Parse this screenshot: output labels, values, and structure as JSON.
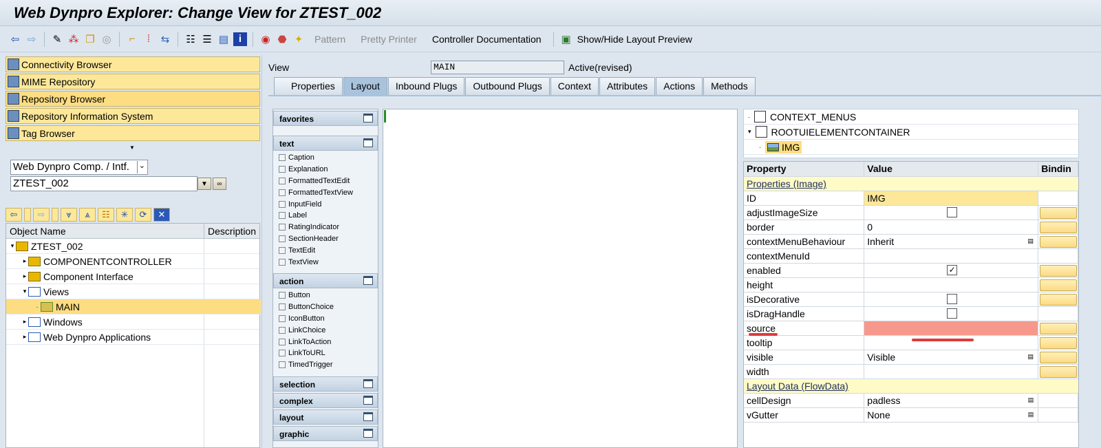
{
  "title": "Web Dynpro Explorer: Change View for ZTEST_002",
  "toolbar": {
    "icons": [
      "back-icon",
      "forward-icon",
      "edit-icon",
      "activate-icon",
      "copy-icon",
      "spiral-icon",
      "hierarchy-up-icon",
      "wand-icon",
      "navigate-icon",
      "tree-icon",
      "stack-icon",
      "layout-icon",
      "info-icon",
      "check-icon",
      "stop-user-icon",
      "magic-icon"
    ],
    "pattern": "Pattern",
    "pretty_printer": "Pretty Printer",
    "controller_doc": "Controller Documentation",
    "layout_preview": "Show/Hide Layout Preview"
  },
  "nav": [
    "Connectivity Browser",
    "MIME Repository",
    "Repository Browser",
    "Repository Information System",
    "Tag Browser"
  ],
  "object_type": "Web Dynpro Comp. / Intf.",
  "object_name": "ZTEST_002",
  "tree": {
    "col_name": "Object Name",
    "col_desc": "Description",
    "items": [
      {
        "label": "ZTEST_002",
        "level": 0
      },
      {
        "label": "COMPONENTCONTROLLER",
        "level": 1
      },
      {
        "label": "Component Interface",
        "level": 1
      },
      {
        "label": "Views",
        "level": 1
      },
      {
        "label": "MAIN",
        "level": 2
      },
      {
        "label": "Windows",
        "level": 1
      },
      {
        "label": "Web Dynpro Applications",
        "level": 1
      }
    ]
  },
  "view": {
    "label": "View",
    "name": "MAIN",
    "status": "Active(revised)"
  },
  "tabs": [
    "Properties",
    "Layout",
    "Inbound Plugs",
    "Outbound Plugs",
    "Context",
    "Attributes",
    "Actions",
    "Methods"
  ],
  "palette": {
    "favorites": "favorites",
    "text": "text",
    "text_items": [
      "Caption",
      "Explanation",
      "FormattedTextEdit",
      "FormattedTextView",
      "InputField",
      "Label",
      "RatingIndicator",
      "SectionHeader",
      "TextEdit",
      "TextView"
    ],
    "action": "action",
    "action_items": [
      "Button",
      "ButtonChoice",
      "IconButton",
      "LinkChoice",
      "LinkToAction",
      "LinkToURL",
      "TimedTrigger"
    ],
    "collapsed": [
      "selection",
      "complex",
      "layout",
      "graphic"
    ]
  },
  "hierarchy": [
    "CONTEXT_MENUS",
    "ROOTUIELEMENTCONTAINER",
    "IMG"
  ],
  "props": {
    "h_prop": "Property",
    "h_val": "Value",
    "h_bind": "Bindin",
    "group1": "Properties (Image)",
    "group2": "Layout Data (FlowData)",
    "rows1": [
      {
        "name": "ID",
        "value": "IMG",
        "bind": false
      },
      {
        "name": "adjustImageSize",
        "check": false,
        "bind": true
      },
      {
        "name": "border",
        "value": "0",
        "bind": true
      },
      {
        "name": "contextMenuBehaviour",
        "value": "Inherit",
        "dd": true,
        "bind": true
      },
      {
        "name": "contextMenuId",
        "value": "",
        "bind": false
      },
      {
        "name": "enabled",
        "check": true,
        "bind": true
      },
      {
        "name": "height",
        "value": "",
        "bind": true
      },
      {
        "name": "isDecorative",
        "check": false,
        "bind": true
      },
      {
        "name": "isDragHandle",
        "check": false,
        "bind": false
      },
      {
        "name": "source",
        "value": "",
        "error": true,
        "bind": true
      },
      {
        "name": "tooltip",
        "value": "",
        "bind": true
      },
      {
        "name": "visible",
        "value": "Visible",
        "dd": true,
        "bind": true
      },
      {
        "name": "width",
        "value": "",
        "bind": true
      }
    ],
    "rows2": [
      {
        "name": "cellDesign",
        "value": "padless",
        "dd": true,
        "bind": false
      },
      {
        "name": "vGutter",
        "value": "None",
        "dd": true,
        "bind": false
      }
    ]
  },
  "colors": {
    "error": "#f7988c",
    "selected": "#fddd82",
    "nav": "#fde89a"
  }
}
